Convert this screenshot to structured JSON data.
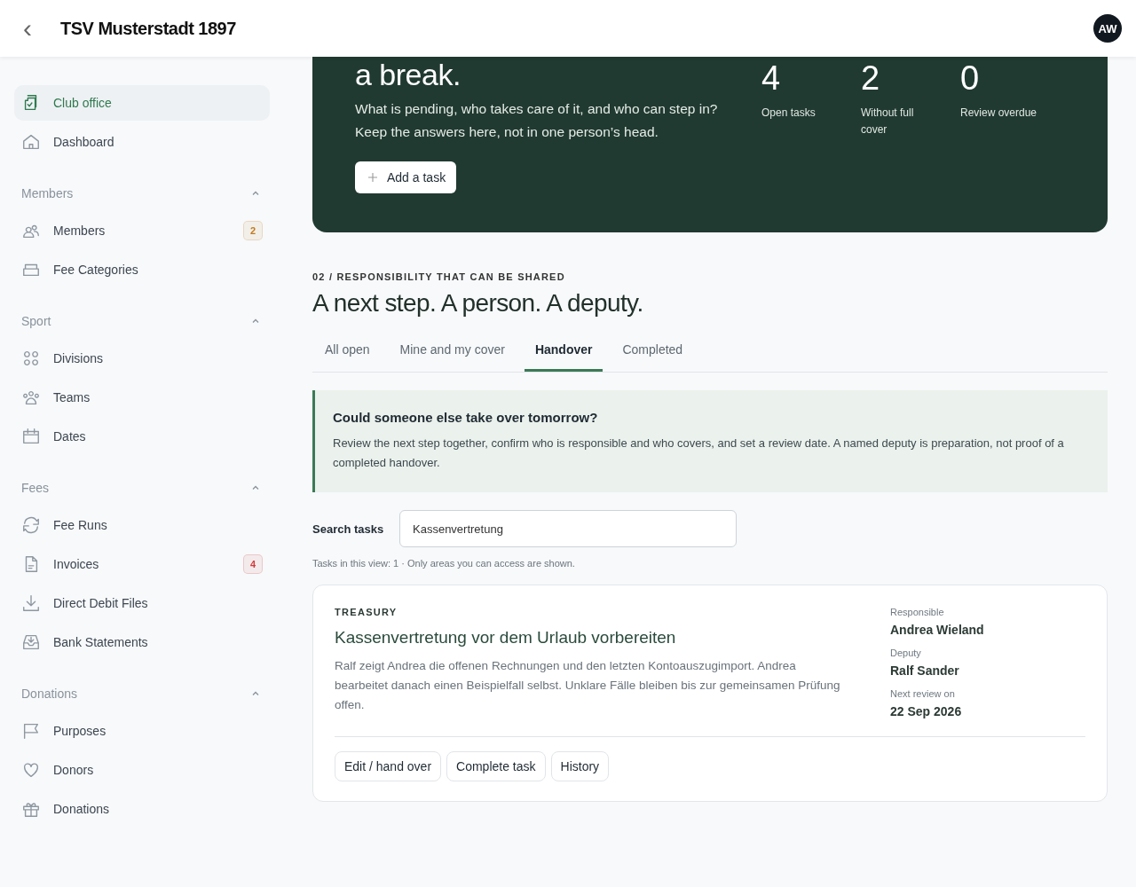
{
  "header": {
    "back": "‹",
    "title": "TSV Musterstadt 1897",
    "avatar": "AW"
  },
  "sidebar": {
    "groups": [
      {
        "items": [
          {
            "label": "Club office",
            "selected": true
          },
          {
            "label": "Dashboard",
            "selected": false
          }
        ]
      },
      {
        "title": "Members",
        "expanded": true,
        "items": [
          {
            "label": "Members",
            "selected": false,
            "badge": {
              "text": "2",
              "color": "#c27a1e"
            }
          },
          {
            "label": "Fee Categories",
            "selected": false
          }
        ]
      },
      {
        "title": "Sport",
        "expanded": true,
        "items": [
          {
            "label": "Divisions",
            "selected": false
          },
          {
            "label": "Teams",
            "selected": false
          },
          {
            "label": "Dates",
            "selected": false
          }
        ]
      },
      {
        "title": "Fees",
        "expanded": true,
        "items": [
          {
            "label": "Fee Runs",
            "selected": false
          },
          {
            "label": "Invoices",
            "selected": false,
            "badge": {
              "text": "4",
              "color": "#d23c3c"
            }
          },
          {
            "label": "Direct Debit Files",
            "selected": false
          },
          {
            "label": "Bank Statements",
            "selected": false
          }
        ]
      },
      {
        "title": "Donations",
        "expanded": true,
        "items": [
          {
            "label": "Purposes",
            "selected": false
          },
          {
            "label": "Donors",
            "selected": false
          },
          {
            "label": "Donations",
            "selected": false
          }
        ]
      }
    ]
  },
  "hero": {
    "heading": "a break.",
    "text": "What is pending, who takes care of it, and who can step in? Keep the answers here, not in one person’s head.",
    "button": "Add a task",
    "stats": [
      {
        "value": "4",
        "label": "Open tasks"
      },
      {
        "value": "2",
        "label": "Without full cover"
      },
      {
        "value": "0",
        "label": "Review overdue"
      }
    ]
  },
  "section": {
    "eyebrow": "02 / RESPONSIBILITY THAT CAN BE SHARED",
    "title": "A next step. A person. A deputy.",
    "tabs": [
      {
        "label": "All open",
        "selected": false
      },
      {
        "label": "Mine and my cover",
        "selected": false
      },
      {
        "label": "Handover",
        "selected": true
      },
      {
        "label": "Completed",
        "selected": false
      }
    ],
    "callout": {
      "title": "Could someone else take over tomorrow?",
      "text": "Review the next step together, confirm who is responsible and who covers, and set a review date. A named deputy is preparation, not proof of a completed handover."
    },
    "search": {
      "label": "Search tasks",
      "value": "Kassenvertretung"
    },
    "count_note": "Tasks in this view: 1 · Only areas you can access are shown.",
    "task": {
      "area": "TREASURY",
      "title": "Kassenvertretung vor dem Urlaub vorbereiten",
      "text": "Ralf zeigt Andrea die offenen Rechnungen und den letzten Kontoauszugimport. Andrea bearbeitet danach einen Beispielfall selbst. Unklare Fälle bleiben bis zur gemeinsamen Prüfung offen.",
      "meta": [
        {
          "label": "Responsible",
          "value": "Andrea Wieland"
        },
        {
          "label": "Deputy",
          "value": "Ralf Sander"
        },
        {
          "label": "Next review on",
          "value": "22 Sep 2026"
        }
      ],
      "actions": [
        "Edit / hand over",
        "Complete task",
        "History"
      ]
    }
  }
}
